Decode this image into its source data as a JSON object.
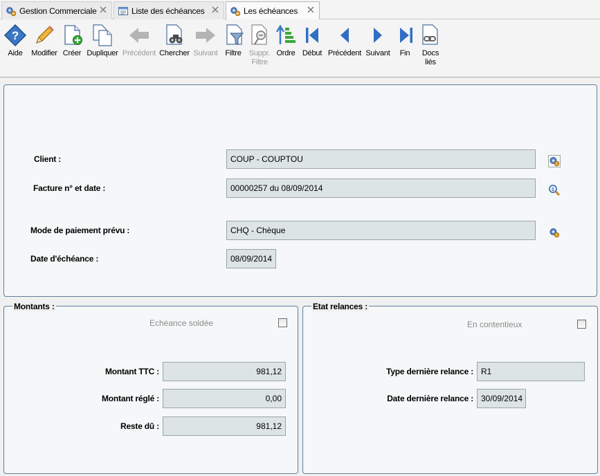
{
  "tabs": [
    {
      "label": "Gestion Commerciale",
      "icon": "gears-icon"
    },
    {
      "label": "Liste des échéances",
      "icon": "list-window-icon"
    },
    {
      "label": "Les échéances",
      "icon": "gears-icon"
    }
  ],
  "toolbar": {
    "aide": "Aide",
    "modifier": "Modifier",
    "creer": "Créer",
    "dupliquer": "Dupliquer",
    "precedent_disabled": "Précédent",
    "chercher": "Chercher",
    "suivant_disabled": "Suivant",
    "filtre": "Filtre",
    "suppr_filtre_1": "Suppr.",
    "suppr_filtre_2": "Filtre",
    "ordre": "Ordre",
    "debut": "Début",
    "precedent": "Précédent",
    "suivant": "Suivant",
    "fin": "Fin",
    "docs_1": "Docs",
    "docs_2": "liés"
  },
  "main": {
    "client_label": "Client :",
    "client_value": "COUP - COUPTOU",
    "facture_label": "Facture n° et date :",
    "facture_value": "00000257 du 08/09/2014",
    "mode_label": "Mode de paiement prévu :",
    "mode_value": "CHQ - Chèque",
    "date_label": "Date d'échéance :",
    "date_value": "08/09/2014"
  },
  "montants": {
    "title": "Montants :",
    "soldee_label": "Echéance soldée",
    "ttc_label": "Montant TTC :",
    "ttc_value": "981,12",
    "regle_label": "Montant réglé :",
    "regle_value": "0,00",
    "reste_label": "Reste dû :",
    "reste_value": "981,12"
  },
  "relances": {
    "title": "Etat relances :",
    "contentieux_label": "En contentieux",
    "type_label": "Type dernière relance :",
    "type_value": "R1",
    "date_label": "Date dernière relance :",
    "date_value": "30/09/2014"
  }
}
